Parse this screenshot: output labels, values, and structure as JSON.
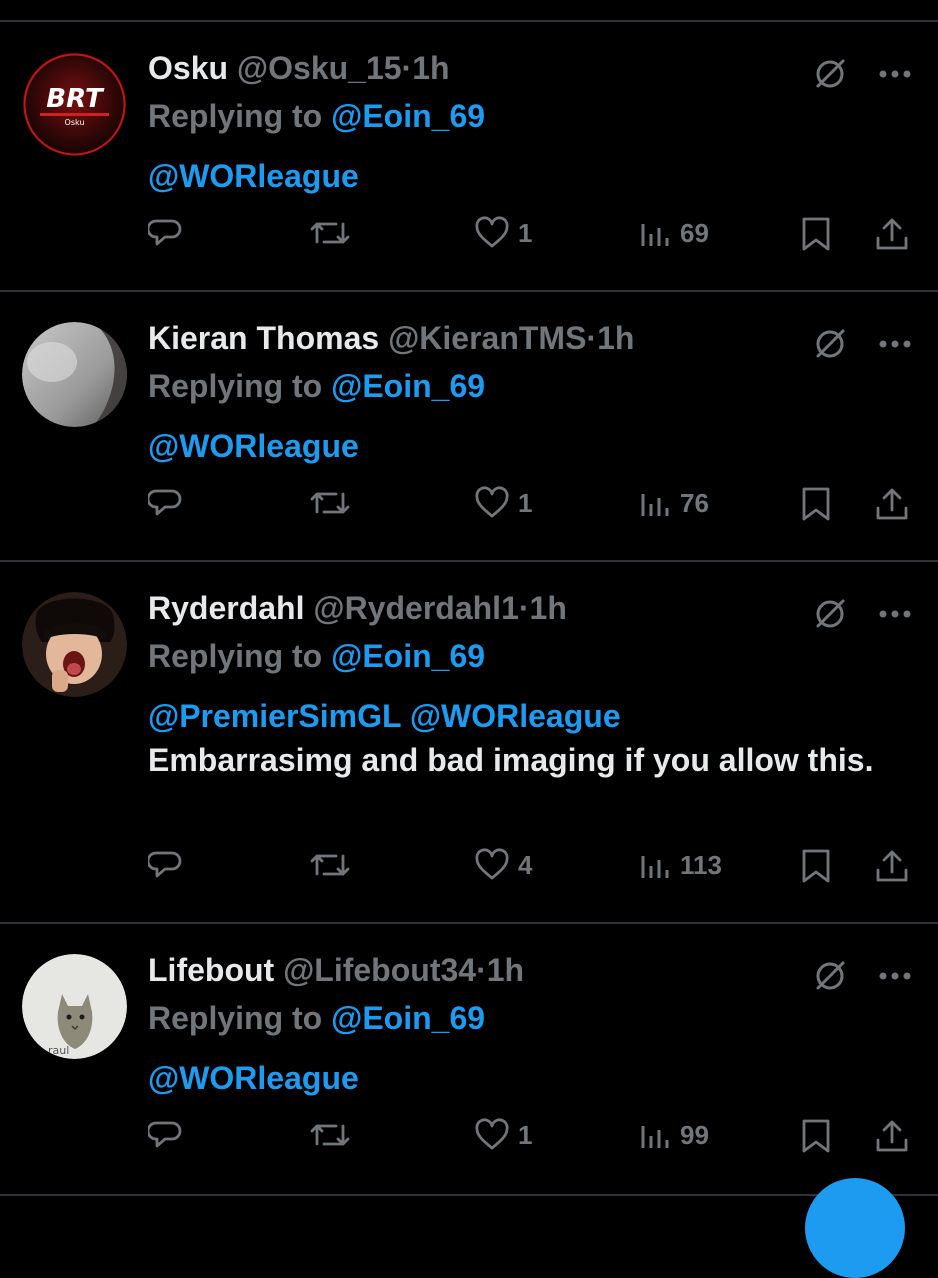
{
  "tweets": [
    {
      "name": "Osku",
      "handle": "@Osku_15",
      "separator": "·",
      "time": "1h",
      "replying_prefix": "Replying to",
      "replying_to": "@Eoin_69",
      "mentions": "@WORleague",
      "text": "",
      "avatar_label": "BRT",
      "avatar_sublabel": "Osku",
      "stats": {
        "replies": "",
        "retweets": "",
        "likes": "1",
        "views": "69"
      }
    },
    {
      "name": "Kieran Thomas",
      "handle": "@KieranTMS",
      "separator": "·",
      "time": "1h",
      "replying_prefix": "Replying to",
      "replying_to": "@Eoin_69",
      "mentions": "@WORleague",
      "text": "",
      "stats": {
        "replies": "",
        "retweets": "",
        "likes": "1",
        "views": "76"
      }
    },
    {
      "name": "Ryderdahl",
      "handle": "@Ryderdahl1",
      "separator": "·",
      "time": "1h",
      "replying_prefix": "Replying to",
      "replying_to": "@Eoin_69",
      "mentions": "@PremierSimGL @WORleague",
      "text": "Embarrasimg and bad imaging if you allow this.",
      "stats": {
        "replies": "",
        "retweets": "",
        "likes": "4",
        "views": "113"
      }
    },
    {
      "name": "Lifebout",
      "handle": "@Lifebout34",
      "separator": "·",
      "time": "1h",
      "replying_prefix": "Replying to",
      "replying_to": "@Eoin_69",
      "mentions": "@WORleague",
      "text": "",
      "avatar_caption": "raul",
      "stats": {
        "replies": "",
        "retweets": "",
        "likes": "1",
        "views": "99"
      }
    }
  ],
  "colors": {
    "background": "#000000",
    "text": "#e7e9ea",
    "muted": "#71767b",
    "link": "#1d9bf0",
    "divider": "#2f3336"
  },
  "icons": [
    "grok-icon",
    "more-icon",
    "reply-icon",
    "retweet-icon",
    "like-icon",
    "views-icon",
    "bookmark-icon",
    "share-icon"
  ]
}
